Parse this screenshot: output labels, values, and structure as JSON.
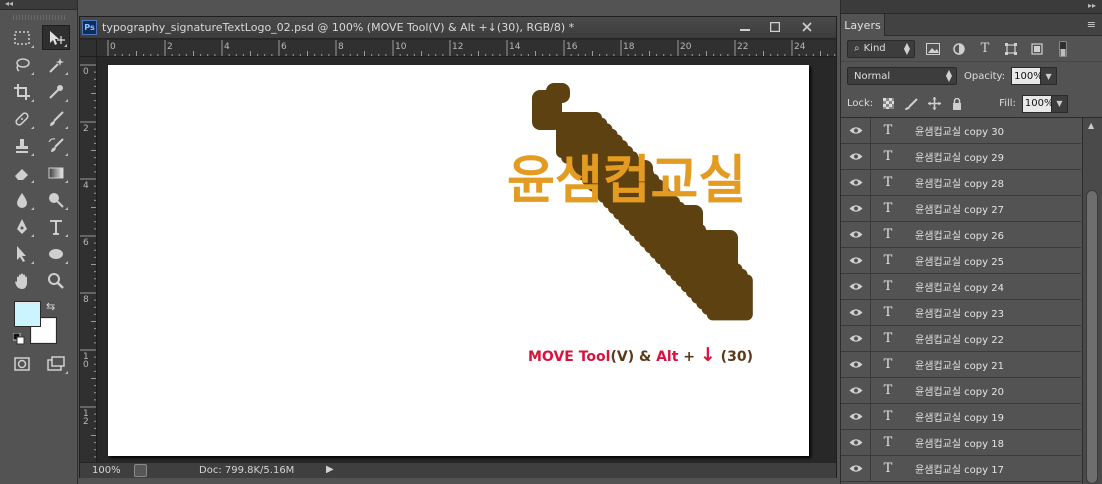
{
  "document": {
    "filename": "typography_signatureTextLogo_02.psd @ 100% (MOVE Tool(V) & Alt +↓(30), RGB/8) *",
    "app_badge": "Ps",
    "ruler_h": [
      "0",
      "2",
      "4",
      "6",
      "8",
      "10",
      "12",
      "14",
      "16",
      "18",
      "20",
      "22",
      "24"
    ],
    "ruler_v": [
      "0",
      "2",
      "4",
      "6",
      "8",
      "1\n0",
      "1\n2"
    ],
    "zoom": "100%",
    "doc_info": "Doc: 799.8K/5.16M"
  },
  "canvas": {
    "logo_text": "윤샘컵교실",
    "logo_color": "#e49b21",
    "shadow_color": "#5e4110",
    "caption": {
      "part1": "MOVE Tool",
      "part2": "(V)",
      "part3": " & ",
      "part4": "Alt",
      "part5": " + ",
      "part6": "↓",
      "part7": " (30)"
    },
    "caption_colors": {
      "red": "#d8143c",
      "dark": "#5b3a1a"
    }
  },
  "tools": {
    "foreground_color": "#ccf4ff",
    "background_color": "#ffffff",
    "swap_symbol": "⇆",
    "collapse": "◂◂"
  },
  "layers_panel": {
    "tab_label": "Layers",
    "collapse": "▸▸",
    "menu_icon": "≡",
    "filter_kind": "Kind",
    "blend_mode": "Normal",
    "opacity_label": "Opacity:",
    "opacity_value": "100%",
    "lock_label": "Lock:",
    "fill_label": "Fill:",
    "fill_value": "100%",
    "layers": [
      {
        "thumb": "T",
        "name": "윤샘컵교실  copy 30"
      },
      {
        "thumb": "T",
        "name": "윤샘컵교실  copy 29"
      },
      {
        "thumb": "T",
        "name": "윤샘컵교실  copy 28"
      },
      {
        "thumb": "T",
        "name": "윤샘컵교실  copy 27"
      },
      {
        "thumb": "T",
        "name": "윤샘컵교실  copy 26"
      },
      {
        "thumb": "T",
        "name": "윤샘컵교실  copy 25"
      },
      {
        "thumb": "T",
        "name": "윤샘컵교실  copy 24"
      },
      {
        "thumb": "T",
        "name": "윤샘컵교실  copy 23"
      },
      {
        "thumb": "T",
        "name": "윤샘컵교실  copy 22"
      },
      {
        "thumb": "T",
        "name": "윤샘컵교실  copy 21"
      },
      {
        "thumb": "T",
        "name": "윤샘컵교실  copy 20"
      },
      {
        "thumb": "T",
        "name": "윤샘컵교실  copy 19"
      },
      {
        "thumb": "T",
        "name": "윤샘컵교실  copy 18"
      },
      {
        "thumb": "T",
        "name": "윤샘컵교실  copy 17"
      }
    ]
  }
}
